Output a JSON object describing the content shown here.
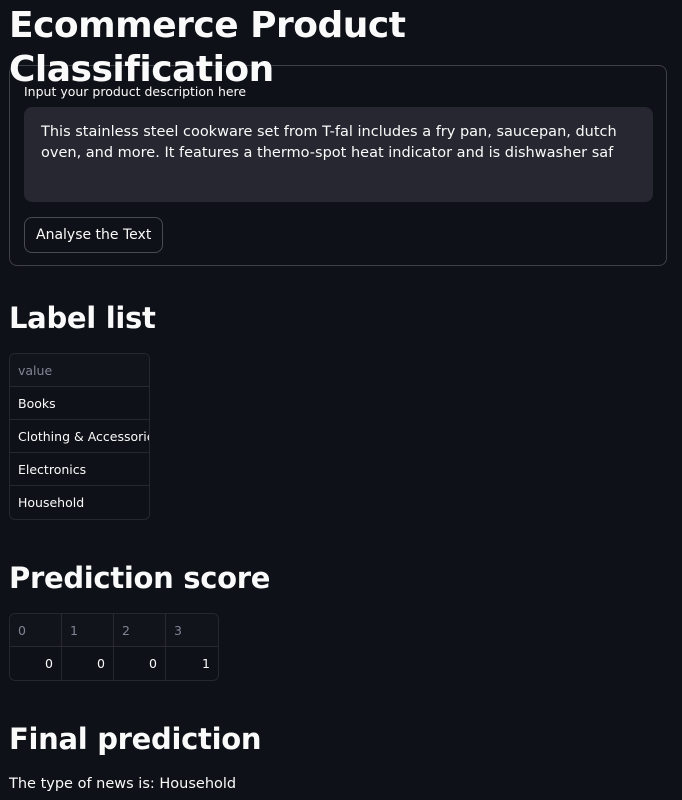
{
  "app": {
    "title": "Ecommerce Product Classification"
  },
  "form": {
    "input_label": "Input your product description here",
    "textarea_value": "This stainless steel cookware set from T-fal includes a fry pan, saucepan, dutch oven, and more. It features a thermo-spot heat indicator and is dishwasher saf",
    "analyse_button": "Analyse the Text"
  },
  "label_list": {
    "heading": "Label list",
    "column_header": "value",
    "rows": [
      "Books",
      "Clothing & Accessories",
      "Electronics",
      "Household"
    ]
  },
  "prediction_score": {
    "heading": "Prediction score",
    "columns": [
      "0",
      "1",
      "2",
      "3"
    ],
    "values": [
      "0",
      "0",
      "0",
      "1"
    ]
  },
  "final_prediction": {
    "heading": "Final prediction",
    "text": "The type of news is: Household"
  },
  "colors": {
    "background": "#0e1117",
    "input_background": "#262730",
    "text": "#fafafa",
    "muted_text": "#808495"
  }
}
